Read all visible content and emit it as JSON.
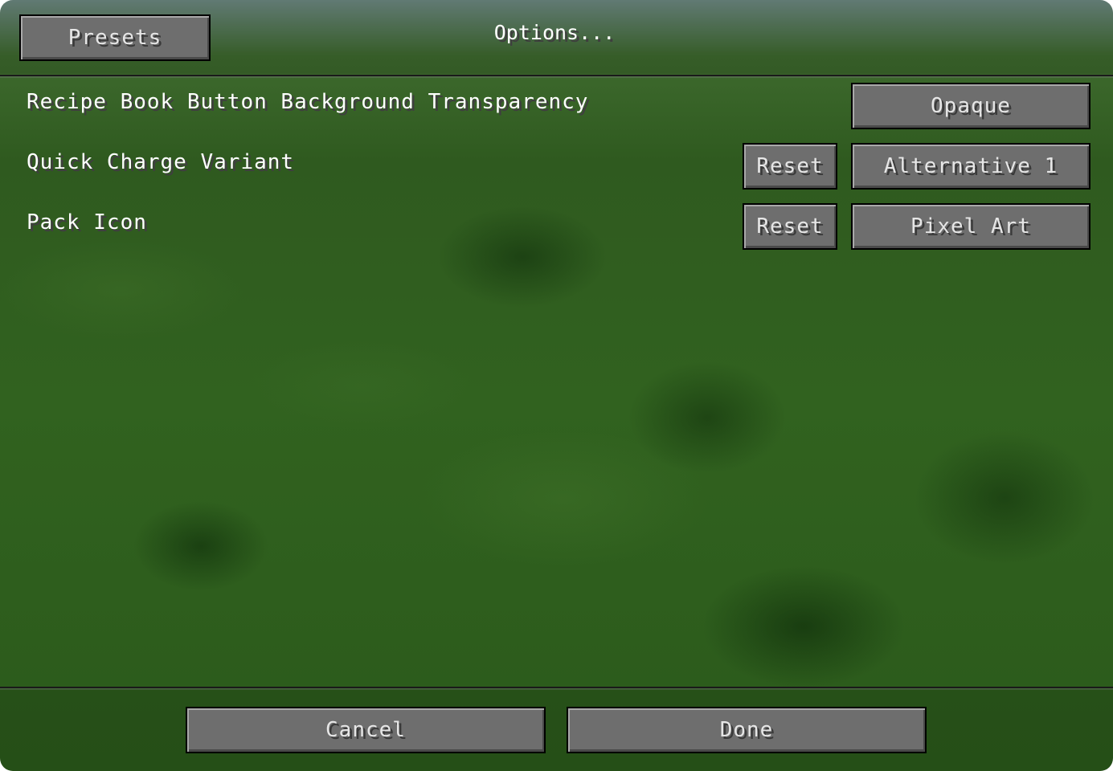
{
  "header": {
    "presets_label": "Presets",
    "title": "Options..."
  },
  "options": [
    {
      "label": "Recipe Book Button Background Transparency",
      "value": "Opaque",
      "reset": ""
    },
    {
      "label": "Quick Charge Variant",
      "value": "Alternative 1",
      "reset": "Reset"
    },
    {
      "label": "Pack Icon",
      "value": "Pixel Art",
      "reset": "Reset"
    }
  ],
  "footer": {
    "cancel_label": "Cancel",
    "done_label": "Done"
  }
}
